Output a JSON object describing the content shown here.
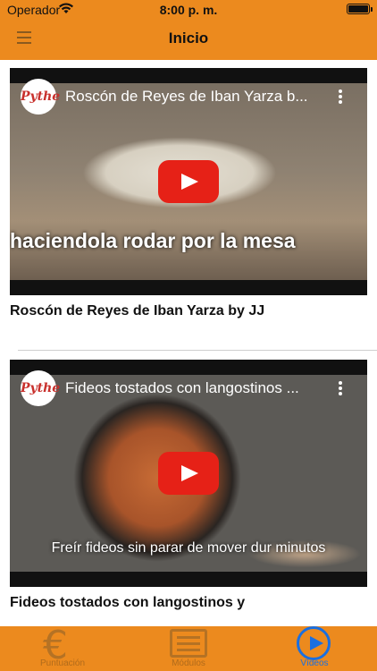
{
  "status_bar": {
    "carrier": "Operador",
    "time": "8:00 p. m."
  },
  "nav": {
    "title": "Inicio",
    "menu_icon": "hamburger-icon"
  },
  "videos": [
    {
      "channel_logo": "Pythe",
      "header_title": "Roscón de Reyes de Iban Yarza b...",
      "caption": "haciendola rodar por la mesa",
      "title": "Roscón de Reyes de Iban Yarza by JJ"
    },
    {
      "channel_logo": "Pythe",
      "header_title": "Fideos tostados con langostinos ...",
      "caption": "Freír fideos sin parar de mover dur minutos",
      "title": "Fideos tostados con langostinos y"
    }
  ],
  "tabbar": {
    "items": [
      {
        "label": "Puntuación",
        "icon": "euro-icon",
        "selected": false
      },
      {
        "label": "Módulos",
        "icon": "modules-icon",
        "selected": false
      },
      {
        "label": "Vídeos",
        "icon": "play-circle-icon",
        "selected": true
      }
    ]
  },
  "colors": {
    "accent": "#ec8a1e",
    "selected_tab": "#1a6fe0",
    "youtube_red": "#e62117"
  }
}
